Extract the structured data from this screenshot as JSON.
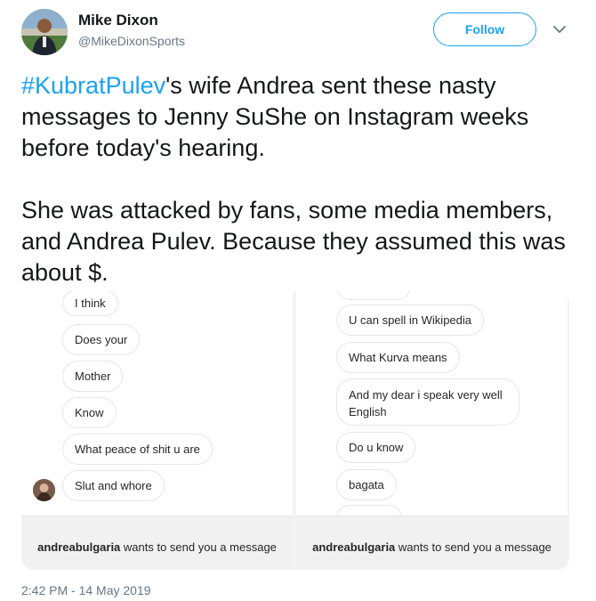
{
  "author": {
    "name": "Mike Dixon",
    "handle": "@MikeDixonSports"
  },
  "follow_label": "Follow",
  "tweet": {
    "hashtag": "#KubratPulev",
    "line1_rest": "'s wife Andrea sent these nasty messages to Jenny SuShe on Instagram weeks before today's hearing.",
    "paragraph2": "She was attacked by fans, some media members, and Andrea Pulev. Because they assumed this was about $."
  },
  "screenshot_left": {
    "messages": [
      "I think",
      "Does your",
      "Mother",
      "Know",
      "What peace of shit u are",
      "Slut and whore"
    ],
    "footer_username": "andreabulgaria",
    "footer_text": " wants to send you a message"
  },
  "screenshot_right": {
    "messages": [
      "U can spell in Wikipedia",
      "What Kurva means",
      "And my dear i speak very well English",
      "Do u know",
      "bagata"
    ],
    "footer_username": "andreabulgaria",
    "footer_text": " wants to send you a message"
  },
  "timestamp": "2:42 PM - 14 May 2019",
  "colors": {
    "accent": "#1da1f2",
    "text": "#14171a",
    "muted": "#657786"
  }
}
